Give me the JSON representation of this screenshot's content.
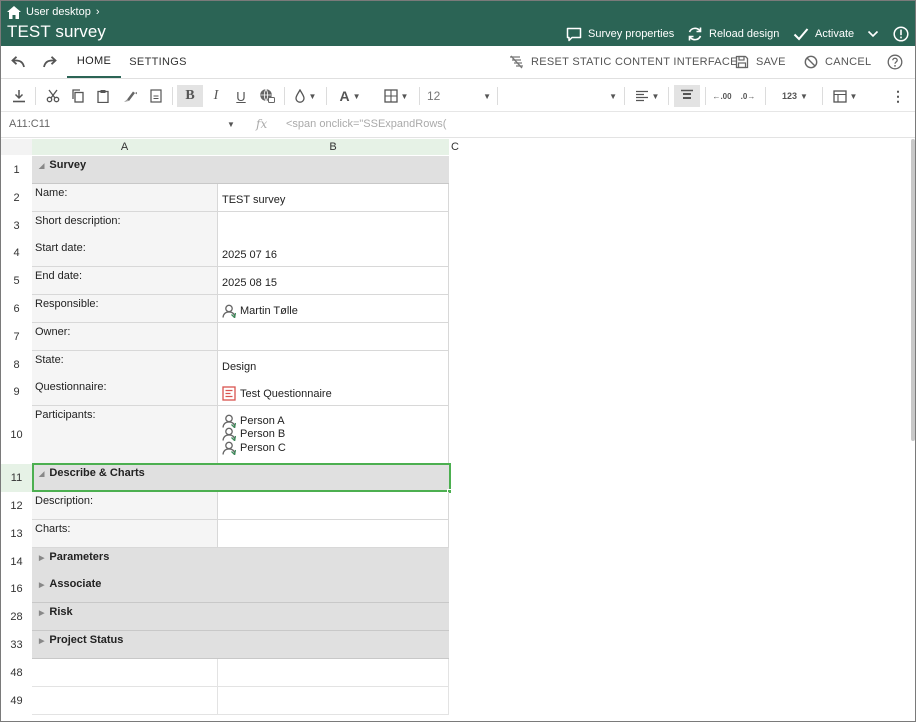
{
  "header": {
    "breadcrumb": "User desktop",
    "title": "TEST survey",
    "survey_properties": "Survey properties",
    "reload_design": "Reload design",
    "activate": "Activate"
  },
  "ribbon": {
    "tabs": [
      "HOME",
      "SETTINGS"
    ],
    "reset": "RESET STATIC CONTENT INTERFACE",
    "save": "SAVE",
    "cancel": "CANCEL"
  },
  "toolbar": {
    "font_size": "12",
    "number_format": "123"
  },
  "formula_bar": {
    "cell_ref": "A11:C11",
    "fx": "fx",
    "formula": "<span onclick=\"SSExpandRows("
  },
  "columns": [
    "A",
    "B",
    "C"
  ],
  "rows": [
    {
      "num": "1",
      "type": "section",
      "label": "Survey",
      "expanded": true
    },
    {
      "num": "2",
      "type": "field",
      "label": "Name:",
      "value": "TEST survey"
    },
    {
      "num": "3",
      "type": "field",
      "label": "Short description:",
      "value": ""
    },
    {
      "num": "4",
      "type": "field",
      "label": "Start date:",
      "value": "2025 07 16"
    },
    {
      "num": "5",
      "type": "field",
      "label": "End date:",
      "value": "2025 08 15"
    },
    {
      "num": "6",
      "type": "field",
      "label": "Responsible:",
      "value": "Martin Tølle",
      "icon": "person-icon"
    },
    {
      "num": "7",
      "type": "field",
      "label": "Owner:",
      "value": ""
    },
    {
      "num": "8",
      "type": "field",
      "label": "State:",
      "value": "Design"
    },
    {
      "num": "9",
      "type": "field",
      "label": "Questionnaire:",
      "value": "Test Questionnaire",
      "icon": "questionnaire-icon"
    },
    {
      "num": "10",
      "type": "participants",
      "label": "Participants:",
      "values": [
        "Person A",
        "Person B",
        "Person C"
      ]
    },
    {
      "num": "11",
      "type": "section",
      "label": "Describe & Charts",
      "expanded": true,
      "selected": true
    },
    {
      "num": "12",
      "type": "field",
      "label": "Description:",
      "value": ""
    },
    {
      "num": "13",
      "type": "field",
      "label": "Charts:",
      "value": ""
    },
    {
      "num": "14",
      "type": "section",
      "label": "Parameters",
      "expanded": false
    },
    {
      "num": "16",
      "type": "section",
      "label": "Associate",
      "expanded": false
    },
    {
      "num": "28",
      "type": "section",
      "label": "Risk",
      "expanded": false
    },
    {
      "num": "33",
      "type": "section",
      "label": "Project Status",
      "expanded": false
    },
    {
      "num": "48",
      "type": "empty"
    },
    {
      "num": "49",
      "type": "empty"
    }
  ],
  "colors": {
    "header_bg": "#2b6455",
    "section_bg": "#e0e0e0",
    "label_bg": "#f5f5f5",
    "selection": "#4caf50",
    "col_head_bg": "#e6f2e6"
  }
}
